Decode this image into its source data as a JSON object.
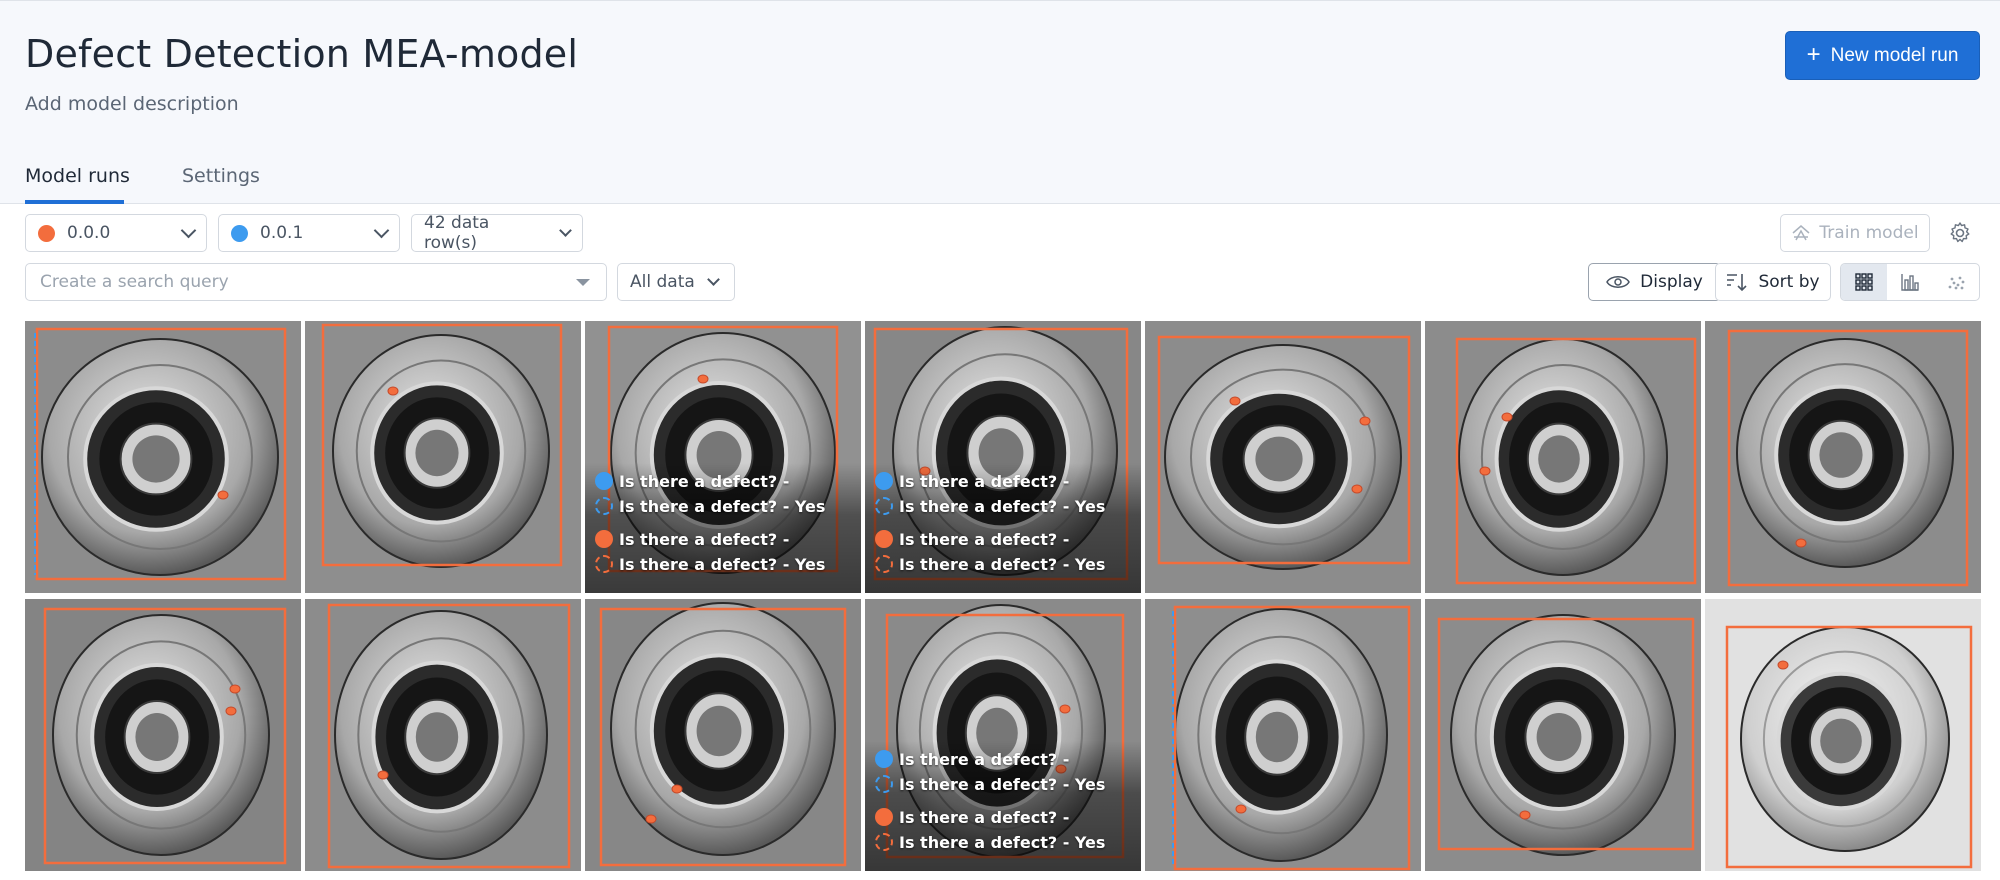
{
  "header": {
    "title": "Defect Detection MEA-model",
    "description": "Add model description",
    "new_run_label": "New model run"
  },
  "tabs": [
    {
      "label": "Model runs",
      "active": true
    },
    {
      "label": "Settings",
      "active": false
    }
  ],
  "filters": {
    "run_a": {
      "label": "0.0.0",
      "color": "#f36d3d"
    },
    "run_b": {
      "label": "0.0.1",
      "color": "#3d9bef"
    },
    "rows": "42 data row(s)",
    "search_placeholder": "Create a search query",
    "data_scope": "All data"
  },
  "toolbar": {
    "train_label": "Train model",
    "display_label": "Display",
    "sort_label": "Sort by",
    "views": [
      "grid-view-icon",
      "chart-view-icon",
      "scatter-view-icon"
    ],
    "active_view": "grid-view-icon"
  },
  "labels": {
    "q_blank": "Is there a defect? -",
    "q_yes": "Is there a defect? - Yes"
  },
  "colors": {
    "accent": "#1f6fd6",
    "orange": "#f36d3d",
    "blue": "#3d9bef"
  }
}
